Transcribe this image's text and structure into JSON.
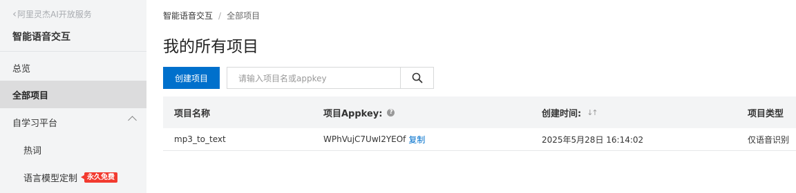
{
  "sidebar": {
    "back_label": "阿里灵杰AI开放服务",
    "product_title": "智能语音交互",
    "items": [
      {
        "label": "总览"
      },
      {
        "label": "全部项目"
      },
      {
        "label": "自学习平台"
      },
      {
        "label": "热词"
      },
      {
        "label": "语言模型定制",
        "badge": "永久免费"
      }
    ]
  },
  "breadcrumb": {
    "root": "智能语音交互",
    "separator": "/",
    "current": "全部项目"
  },
  "page_title": "我的所有项目",
  "toolbar": {
    "create_label": "创建项目",
    "search_placeholder": "请输入项目名或appkey"
  },
  "table": {
    "columns": [
      "项目名称",
      "项目Appkey:",
      "创建时间:",
      "项目类型"
    ],
    "rows": [
      {
        "name": "mp3_to_text",
        "appkey": "WPhVujC7UwI2YEOf",
        "copy_label": "复制",
        "created": "2025年5月28日 16:14:02",
        "type": "仅语音识别"
      }
    ]
  },
  "colors": {
    "primary": "#0070cc",
    "sidebar_bg": "#f3f4f5",
    "active_bg": "#dcdcdd",
    "badge": "#f23a2f"
  },
  "icons": {
    "back": "chevron-left-icon",
    "collapse": "chevron-up-icon",
    "search": "search-icon",
    "help": "question-circle-icon",
    "sort": "sort-icon"
  }
}
